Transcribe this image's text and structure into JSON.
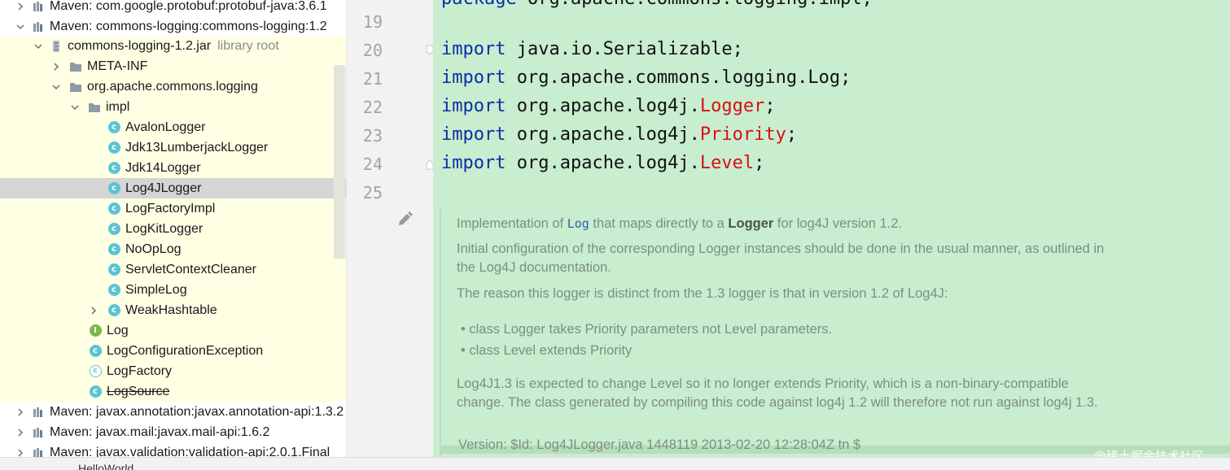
{
  "tree": {
    "items": [
      {
        "label": "Maven: com.google.protobuf:protobuf-java:3.6.1",
        "hint": "",
        "icon": "library-icon"
      },
      {
        "label": "Maven: commons-logging:commons-logging:1.2",
        "hint": "",
        "icon": "library-icon"
      },
      {
        "label": "commons-logging-1.2.jar",
        "hint": "library root",
        "icon": "jar-icon"
      },
      {
        "label": "META-INF",
        "hint": "",
        "icon": "folder-icon"
      },
      {
        "label": "org.apache.commons.logging",
        "hint": "",
        "icon": "package-icon"
      },
      {
        "label": "impl",
        "hint": "",
        "icon": "package-icon"
      },
      {
        "label": "AvalonLogger",
        "hint": "",
        "icon": "class-icon"
      },
      {
        "label": "Jdk13LumberjackLogger",
        "hint": "",
        "icon": "class-icon"
      },
      {
        "label": "Jdk14Logger",
        "hint": "",
        "icon": "class-icon"
      },
      {
        "label": "Log4JLogger",
        "hint": "",
        "icon": "class-icon"
      },
      {
        "label": "LogFactoryImpl",
        "hint": "",
        "icon": "class-icon"
      },
      {
        "label": "LogKitLogger",
        "hint": "",
        "icon": "class-icon"
      },
      {
        "label": "NoOpLog",
        "hint": "",
        "icon": "class-icon"
      },
      {
        "label": "ServletContextCleaner",
        "hint": "",
        "icon": "class-icon"
      },
      {
        "label": "SimpleLog",
        "hint": "",
        "icon": "class-icon"
      },
      {
        "label": "WeakHashtable",
        "hint": "",
        "icon": "class-icon"
      },
      {
        "label": "Log",
        "hint": "",
        "icon": "interface-icon"
      },
      {
        "label": "LogConfigurationException",
        "hint": "",
        "icon": "class-icon"
      },
      {
        "label": "LogFactory",
        "hint": "",
        "icon": "abstract-class-icon"
      },
      {
        "label": "LogSource",
        "hint": "",
        "icon": "class-icon"
      },
      {
        "label": "Maven: javax.annotation:javax.annotation-api:1.3.2",
        "hint": "",
        "icon": "library-icon"
      },
      {
        "label": "Maven: javax.mail:javax.mail-api:1.6.2",
        "hint": "",
        "icon": "library-icon"
      },
      {
        "label": "Maven: javax.validation:validation-api:2.0.1.Final",
        "hint": "",
        "icon": "library-icon"
      }
    ]
  },
  "gutter": {
    "line_numbers": [
      "19",
      "20",
      "21",
      "22",
      "23",
      "24",
      "25"
    ]
  },
  "code": {
    "lines": [
      {
        "kw": "import",
        "pkg": " java.io.Serializable;",
        "ref": "",
        "end": ""
      },
      {
        "kw": "import",
        "pkg": " org.apache.commons.logging.Log;",
        "ref": "",
        "end": ""
      },
      {
        "kw": "import",
        "pkg": " org.apache.log4j.",
        "ref": "Logger",
        "end": ";"
      },
      {
        "kw": "import",
        "pkg": " org.apache.log4j.",
        "ref": "Priority",
        "end": ";"
      },
      {
        "kw": "import",
        "pkg": " org.apache.log4j.",
        "ref": "Level",
        "end": ";"
      }
    ],
    "colors": {
      "keyword": "#0a2fa6",
      "unresolved": "#d4120f",
      "background": "#c9edcf"
    }
  },
  "doc": {
    "p1_a": "Implementation of ",
    "p1_code": "Log",
    "p1_b": " that maps directly to a ",
    "p1_bold": "Logger",
    "p1_c": " for log4J version 1.2.",
    "p2": "Initial configuration of the corresponding Logger instances should be done in the usual manner, as outlined in the Log4J documentation.",
    "p3": "The reason this logger is distinct from the 1.3 logger is that in version 1.2 of Log4J:",
    "bullet1": "class Logger takes Priority parameters not Level parameters.",
    "bullet2": "class Level extends Priority",
    "p4": "Log4J1.3 is expected to change Level so it no longer extends Priority, which is a non-binary-compatible change. The class generated by compiling this code against log4j 1.2 will therefore not run against log4j 1.3.",
    "version": "Version: $Id: Log4JLogger.java 1448119 2013-02-20 12:28:04Z tn $"
  },
  "bottom_bar": {
    "tab_label": "HelloWorld"
  },
  "watermark": "@稀土掘金技术社区"
}
